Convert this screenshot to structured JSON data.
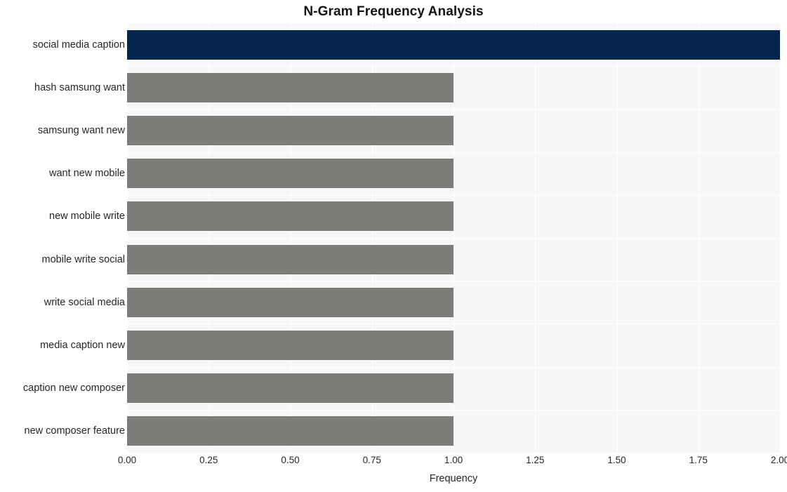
{
  "chart_data": {
    "type": "bar",
    "orientation": "horizontal",
    "title": "N-Gram Frequency Analysis",
    "xlabel": "Frequency",
    "ylabel": "",
    "categories": [
      "social media caption",
      "hash samsung want",
      "samsung want new",
      "want new mobile",
      "new mobile write",
      "mobile write social",
      "write social media",
      "media caption new",
      "caption new composer",
      "new composer feature"
    ],
    "values": [
      2,
      1,
      1,
      1,
      1,
      1,
      1,
      1,
      1,
      1
    ],
    "bar_colors": [
      "#062450",
      "#7c7c79",
      "#7c7c79",
      "#7c7c79",
      "#7c7c79",
      "#7c7c79",
      "#7c7c79",
      "#7c7c79",
      "#7c7c79",
      "#7c7c79"
    ],
    "xlim": [
      0,
      2
    ],
    "xticks": [
      0,
      0.25,
      0.5,
      0.75,
      1,
      1.25,
      1.5,
      1.75,
      2
    ],
    "xtick_labels": [
      "0.00",
      "0.25",
      "0.50",
      "0.75",
      "1.00",
      "1.25",
      "1.50",
      "1.75",
      "2.00"
    ],
    "grid": true,
    "grid_color": "#ffffff",
    "plot_background": "#f7f7f7",
    "figure_background": "#ffffff",
    "legend": null
  }
}
